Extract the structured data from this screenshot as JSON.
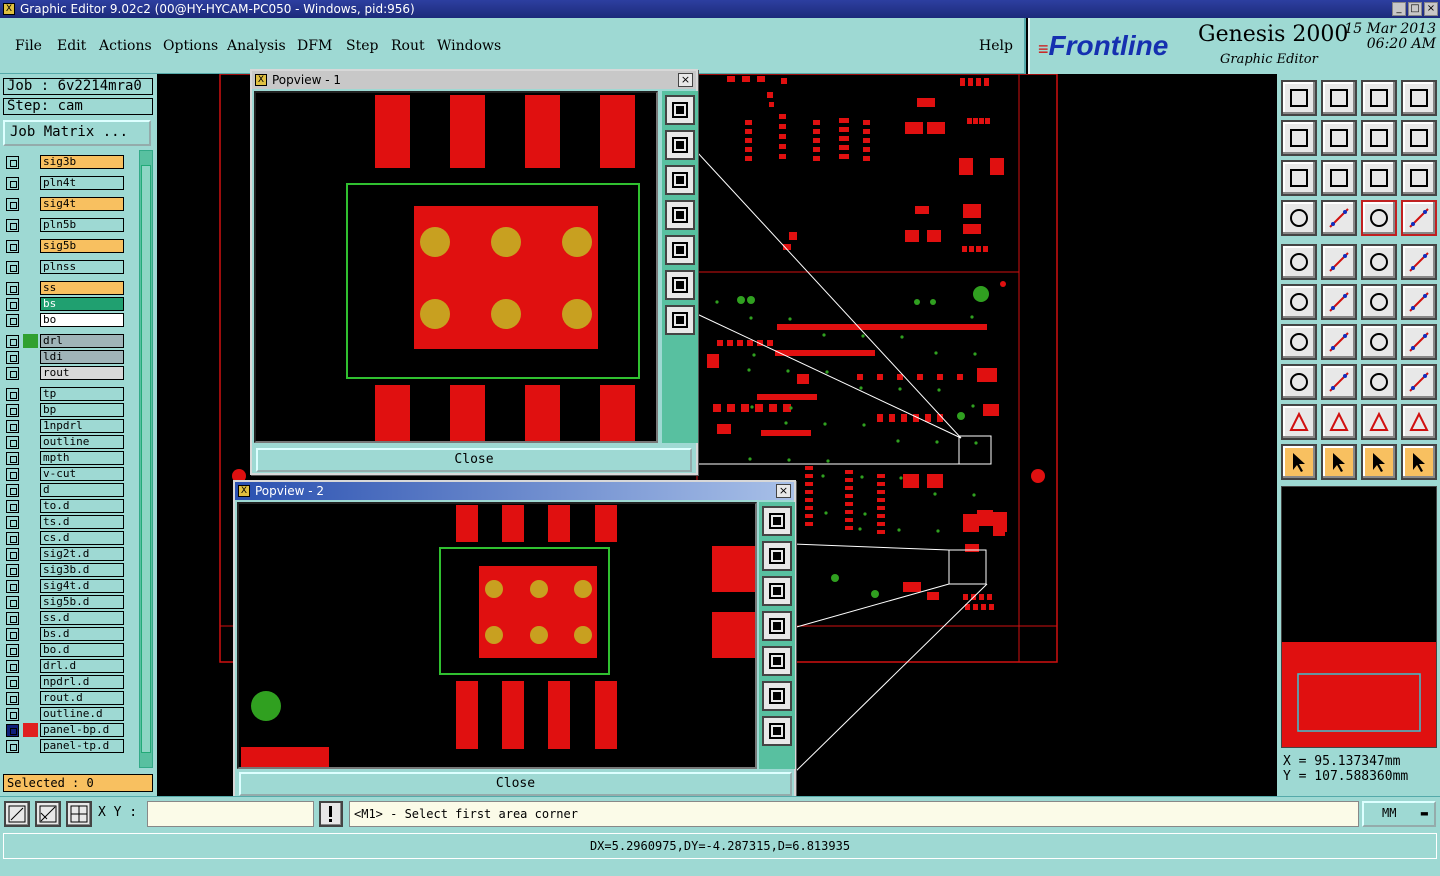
{
  "window": {
    "title": "Graphic Editor 9.02c2 (00@HY-HYCAM-PC050 - Windows, pid:956)",
    "icon": "x-app-icon"
  },
  "menu": {
    "file": "File",
    "edit": "Edit",
    "actions": "Actions",
    "options": "Options",
    "analysis": "Analysis",
    "dfm": "DFM",
    "step": "Step",
    "rout": "Rout",
    "windows": "Windows",
    "help": "Help"
  },
  "brand": {
    "logo_prefix": "F",
    "logo_rest": "rontline",
    "product": "Genesis 2000",
    "subtitle": "Graphic Editor",
    "date": "15 Mar 2013",
    "time": "06:20 AM"
  },
  "job": {
    "label": "Job : 6v2214mra0",
    "step": "Step: cam",
    "matrix_button": "Job Matrix ..."
  },
  "layers": [
    {
      "name": "sig3b",
      "color": "#f8c060"
    },
    {
      "name": "pln4t",
      "color": "#9ed9d3"
    },
    {
      "name": "sig4t",
      "color": "#f8c060"
    },
    {
      "name": "pln5b",
      "color": "#9ed9d3"
    },
    {
      "name": "sig5b",
      "color": "#f8c060"
    },
    {
      "name": "plnss",
      "color": "#9ed9d3"
    },
    {
      "name": "ss",
      "color": "#f8c060"
    },
    {
      "name": "bs",
      "color": "#20a070"
    },
    {
      "name": "bo",
      "color": "#ffffff"
    },
    {
      "name": "drl",
      "color": "#a0b4b8",
      "swatch": "#30a030"
    },
    {
      "name": "ldi",
      "color": "#a0b4b8"
    },
    {
      "name": "rout",
      "color": "#d8d8d8"
    },
    {
      "name": "tp",
      "color": "#9ed9d3"
    },
    {
      "name": "bp",
      "color": "#9ed9d3"
    },
    {
      "name": "1npdrl",
      "color": "#9ed9d3"
    },
    {
      "name": "outline",
      "color": "#9ed9d3"
    },
    {
      "name": "mpth",
      "color": "#9ed9d3"
    },
    {
      "name": "v-cut",
      "color": "#9ed9d3"
    },
    {
      "name": "d",
      "color": "#9ed9d3"
    },
    {
      "name": "to.d",
      "color": "#9ed9d3"
    },
    {
      "name": "ts.d",
      "color": "#9ed9d3"
    },
    {
      "name": "cs.d",
      "color": "#9ed9d3"
    },
    {
      "name": "sig2t.d",
      "color": "#9ed9d3"
    },
    {
      "name": "sig3b.d",
      "color": "#9ed9d3"
    },
    {
      "name": "sig4t.d",
      "color": "#9ed9d3"
    },
    {
      "name": "sig5b.d",
      "color": "#9ed9d3"
    },
    {
      "name": "ss.d",
      "color": "#9ed9d3"
    },
    {
      "name": "bs.d",
      "color": "#9ed9d3"
    },
    {
      "name": "bo.d",
      "color": "#9ed9d3"
    },
    {
      "name": "drl.d",
      "color": "#9ed9d3"
    },
    {
      "name": "npdrl.d",
      "color": "#9ed9d3"
    },
    {
      "name": "rout.d",
      "color": "#9ed9d3"
    },
    {
      "name": "outline.d",
      "color": "#9ed9d3"
    },
    {
      "name": "panel-bp.d",
      "color": "#9ed9d3",
      "swatch": "#e02020",
      "checked": true
    },
    {
      "name": "panel-tp.d",
      "color": "#9ed9d3"
    }
  ],
  "selected": "Selected : 0",
  "popview1": {
    "title": "Popview - 1",
    "close": "Close"
  },
  "popview2": {
    "title": "Popview - 2",
    "close": "Close"
  },
  "coords": {
    "x": "X = 95.137347mm",
    "y": "Y = 107.588360mm"
  },
  "bottom": {
    "xy_label": "X Y :",
    "xy_value": "",
    "message": "<M1> - Select first area corner",
    "units": "MM",
    "status": "DX=5.2960975,DY=-4.287315,D=6.813935"
  },
  "tools": [
    "home-top-icon",
    "home-bottom-icon",
    "house-icon",
    "panel-window-icon",
    "pan-left-icon",
    "pan-right-icon",
    "zoom-back-icon",
    "zoom-page-icon",
    "fit-screen-icon",
    "fit-window-icon",
    "scale-1-2-icon",
    "help-icon",
    "layer-select-icon",
    "net-icon",
    "feature-toggle-icon",
    "feature-highlight-icon",
    "move-icon",
    "line-draw-icon",
    "ruler-icon",
    "pad-icon",
    "node-icon",
    "cross-icon",
    "connect-icon",
    "snap-icon",
    "angle-icon",
    "diagonal-icon",
    "arc-icon",
    "text-ff-icon",
    "pad-add-icon",
    "segment-icon",
    "measure-icon",
    "shape-icon",
    "triangle-a-icon",
    "triangle-b-icon",
    "triangle-c-icon",
    "triangle-d-icon",
    "pointer-icon",
    "select-pointer-icon",
    "select-box-icon",
    "route-icon"
  ]
}
